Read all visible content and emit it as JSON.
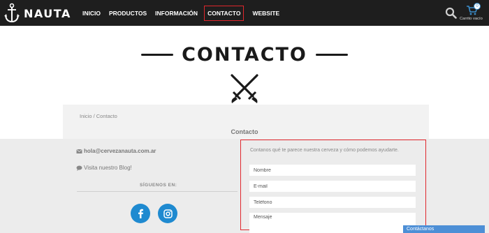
{
  "header": {
    "brand": "NAUTA",
    "nav": [
      {
        "label": "INICIO"
      },
      {
        "label": "PRODUCTOS"
      },
      {
        "label": "INFORMACIÓN"
      },
      {
        "label": "CONTACTO"
      },
      {
        "label": "WEBSITE"
      }
    ],
    "active_nav": "CONTACTO",
    "search_icon": "search-icon",
    "cart": {
      "label": "Carrito vacío",
      "count": "0"
    }
  },
  "hero": {
    "title": "CONTACTO",
    "emblem": "crossed-swords-icon"
  },
  "breadcrumb": "Inicio / Contacto",
  "section_title": "Contacto",
  "contact_info": {
    "email": "hola@cervezanauta.com.ar",
    "blog": "Visita nuestro Blog!",
    "follow_label": "SÍGUENOS EN:"
  },
  "form": {
    "intro": "Contanos qué te parece nuestra cerveza y cómo podemos ayudarte.",
    "name_placeholder": "Nombre",
    "email_placeholder": "E-mail",
    "phone_placeholder": "Teléfono",
    "message_placeholder": "Mensaje"
  },
  "floating_tab": "Contáctanos",
  "colors": {
    "accent": "#e0262c",
    "brand_blue": "#1f8ad0",
    "header_bg": "#1e1e1e"
  }
}
